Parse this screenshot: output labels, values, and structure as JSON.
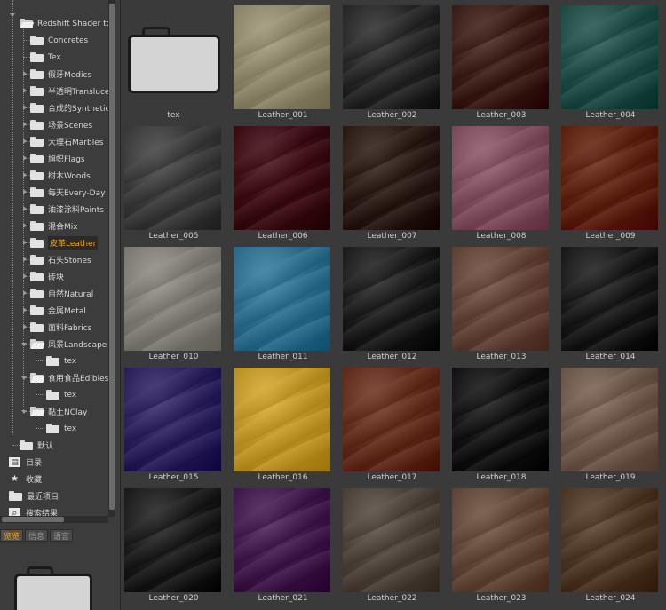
{
  "tree": {
    "root": "Redshift Shader to",
    "items": [
      {
        "label": "Concretes",
        "open": false,
        "arrow": false
      },
      {
        "label": "Tex",
        "open": false,
        "arrow": false
      },
      {
        "label": "假牙Medics",
        "open": false,
        "arrow": true
      },
      {
        "label": "半透明Transluce",
        "open": false,
        "arrow": true
      },
      {
        "label": "合成的Synthetic",
        "open": false,
        "arrow": true
      },
      {
        "label": "场景Scenes",
        "open": false,
        "arrow": true
      },
      {
        "label": "大理石Marbles",
        "open": false,
        "arrow": true
      },
      {
        "label": "旗帜Flags",
        "open": false,
        "arrow": true
      },
      {
        "label": "树木Woods",
        "open": false,
        "arrow": true
      },
      {
        "label": "每天Every-Day",
        "open": false,
        "arrow": true
      },
      {
        "label": "油漆涂料Paints",
        "open": false,
        "arrow": true
      },
      {
        "label": "混合Mix",
        "open": false,
        "arrow": true
      },
      {
        "label": "皮革Leather",
        "open": false,
        "arrow": true,
        "selected": true
      },
      {
        "label": "石头Stones",
        "open": false,
        "arrow": true
      },
      {
        "label": "砖块",
        "open": false,
        "arrow": true
      },
      {
        "label": "自然Natural",
        "open": false,
        "arrow": true
      },
      {
        "label": "金属Metal",
        "open": false,
        "arrow": true
      },
      {
        "label": "面料Fabrics",
        "open": false,
        "arrow": true
      },
      {
        "label": "风景Landscape",
        "open": true,
        "arrow": true
      },
      {
        "label": "tex",
        "open": false,
        "arrow": false,
        "child": true
      },
      {
        "label": "食用食品Edibles",
        "open": true,
        "arrow": true
      },
      {
        "label": "tex",
        "open": false,
        "arrow": false,
        "child": true
      },
      {
        "label": "黏土NClay",
        "open": true,
        "arrow": true
      },
      {
        "label": "tex",
        "open": false,
        "arrow": false,
        "child": true
      }
    ],
    "default_label": "默认",
    "system": [
      {
        "label": "目录",
        "icon": "catalog-icon"
      },
      {
        "label": "收藏",
        "icon": "star-icon"
      },
      {
        "label": "最近项目",
        "icon": "folder-icon"
      },
      {
        "label": "搜索结果",
        "icon": "search-icon"
      }
    ]
  },
  "tabs": [
    "览览",
    "信息",
    "语言"
  ],
  "grid": {
    "items": [
      {
        "name": "tex",
        "kind": "folder"
      },
      {
        "name": "Leather_001",
        "color": "#8a8266"
      },
      {
        "name": "Leather_002",
        "color": "#262626"
      },
      {
        "name": "Leather_003",
        "color": "#3a1c16"
      },
      {
        "name": "Leather_004",
        "color": "#1f4a44"
      },
      {
        "name": "Leather_005",
        "color": "#383838"
      },
      {
        "name": "Leather_006",
        "color": "#3a0a12"
      },
      {
        "name": "Leather_007",
        "color": "#2a1a14"
      },
      {
        "name": "Leather_008",
        "color": "#7a4a5a"
      },
      {
        "name": "Leather_009",
        "color": "#5a200e"
      },
      {
        "name": "Leather_010",
        "color": "#7a7870"
      },
      {
        "name": "Leather_011",
        "color": "#2a6a88"
      },
      {
        "name": "Leather_012",
        "color": "#1c1c1c"
      },
      {
        "name": "Leather_013",
        "color": "#5e4034"
      },
      {
        "name": "Leather_014",
        "color": "#181818"
      },
      {
        "name": "Leather_015",
        "color": "#2a1f58"
      },
      {
        "name": "Leather_016",
        "color": "#b89024"
      },
      {
        "name": "Leather_017",
        "color": "#5e2a1a"
      },
      {
        "name": "Leather_018",
        "color": "#121212"
      },
      {
        "name": "Leather_019",
        "color": "#6a5448"
      },
      {
        "name": "Leather_020",
        "color": "#1a1a1a"
      },
      {
        "name": "Leather_021",
        "color": "#3e1848"
      },
      {
        "name": "Leather_022",
        "color": "#4a4038"
      },
      {
        "name": "Leather_023",
        "color": "#5e4434"
      },
      {
        "name": "Leather_024",
        "color": "#4a3424"
      }
    ]
  }
}
